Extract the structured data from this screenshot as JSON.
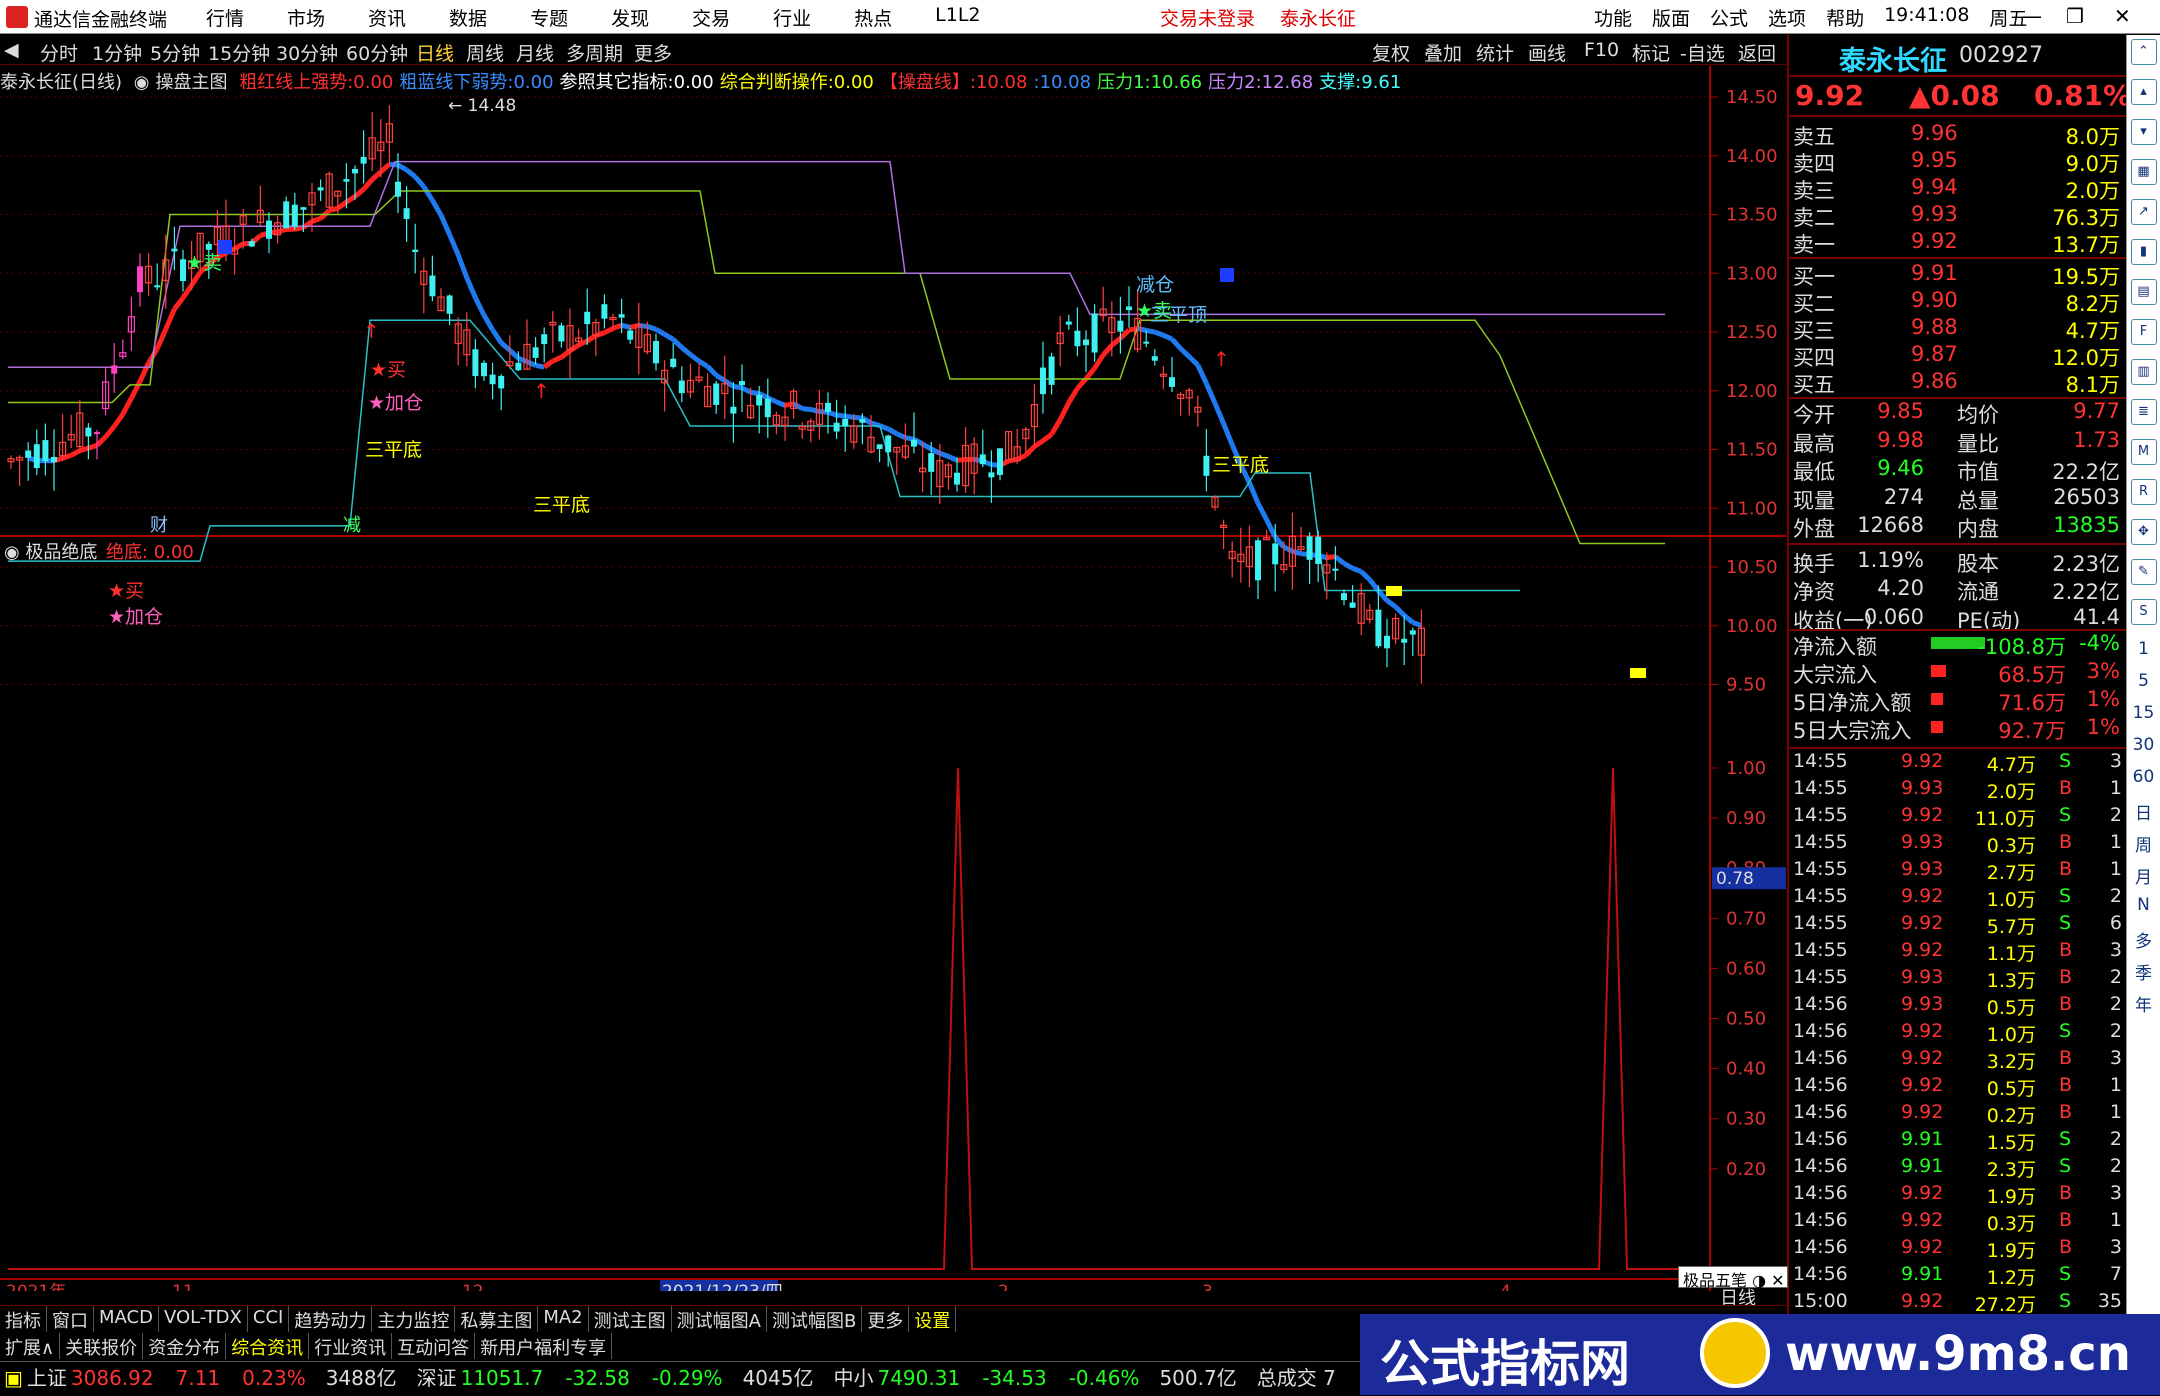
{
  "titlebar": {
    "app_name": "通达信金融终端",
    "menu": [
      "行情",
      "市场",
      "资讯",
      "数据",
      "专题",
      "发现",
      "交易",
      "行业",
      "热点",
      "L1L2"
    ],
    "login_status": "交易未登录",
    "stock_name": "泰永长征",
    "right_menu": [
      "功能",
      "版面",
      "公式",
      "选项",
      "帮助"
    ],
    "clock": "19:41:08",
    "weekday": "周五"
  },
  "period_bar": {
    "periods": [
      "分时",
      "1分钟",
      "5分钟",
      "15分钟",
      "30分钟",
      "60分钟",
      "日线",
      "周线",
      "月线",
      "多周期",
      "更多"
    ],
    "active": "日线",
    "tools": [
      "复权",
      "叠加",
      "统计",
      "画线",
      "F10",
      "标记",
      "-自选",
      "返回"
    ]
  },
  "main_indicator": {
    "title": "泰永长征(日线)",
    "formula": "操盘主图",
    "items": [
      {
        "label": "粗红线上强势:",
        "value": "0.00",
        "color": "#ff3030"
      },
      {
        "label": "粗蓝线下弱势:",
        "value": "0.00",
        "color": "#3a8cff"
      },
      {
        "label": "参照其它指标:",
        "value": "0.00",
        "color": "#ffffff"
      },
      {
        "label": "综合判断操作:",
        "value": "0.00",
        "color": "#ffff00"
      },
      {
        "label": "【操盘线】:",
        "value": "10.08",
        "color": "#ff3030"
      },
      {
        "label": ":",
        "value": "10.08",
        "color": "#3a8cff"
      },
      {
        "label": "压力1:",
        "value": "10.66",
        "color": "#44ff44"
      },
      {
        "label": "压力2:",
        "value": "12.68",
        "color": "#cc88ff"
      },
      {
        "label": "支撑:",
        "value": "9.61",
        "color": "#44ffff"
      }
    ],
    "high_label": "14.48"
  },
  "chart_data": [
    {
      "type": "candlestick",
      "title": "泰永长征(日线)",
      "y_ticks": [
        "14.50",
        "14.00",
        "13.50",
        "13.00",
        "12.50",
        "12.00",
        "11.50",
        "11.00",
        "10.50",
        "10.00",
        "9.50"
      ],
      "ylim": [
        9.25,
        14.55
      ],
      "annotations": [
        "★卖",
        "★买",
        "★加仓",
        "三平底",
        "三平底",
        "减仓",
        "★卖",
        "三平顶",
        "三平底",
        "★买",
        "★加仓"
      ],
      "x_labels": [
        "2021年",
        "11",
        "12",
        "2021/12/23/四",
        "2",
        "3",
        "4"
      ],
      "markers": [
        "财",
        "减"
      ]
    },
    {
      "type": "line",
      "title": "极品绝底",
      "series": [
        {
          "name": "绝底",
          "value": "0.00"
        }
      ],
      "y_ticks": [
        "1.00",
        "0.90",
        "0.80",
        "0.70",
        "0.60",
        "0.50",
        "0.40",
        "0.30",
        "0.20"
      ],
      "ylim": [
        0,
        1.07
      ],
      "cursor_value": "0.78",
      "spikes": [
        1,
        1
      ]
    }
  ],
  "quote": {
    "name": "泰永长征",
    "code": "002927",
    "price": "9.92",
    "change": "▲0.08",
    "pct": "0.81%",
    "asks": [
      {
        "label": "卖五",
        "price": "9.96",
        "vol": "8.0万"
      },
      {
        "label": "卖四",
        "price": "9.95",
        "vol": "9.0万"
      },
      {
        "label": "卖三",
        "price": "9.94",
        "vol": "2.0万"
      },
      {
        "label": "卖二",
        "price": "9.93",
        "vol": "76.3万"
      },
      {
        "label": "卖一",
        "price": "9.92",
        "vol": "13.7万"
      }
    ],
    "bids": [
      {
        "label": "买一",
        "price": "9.91",
        "vol": "19.5万"
      },
      {
        "label": "买二",
        "price": "9.90",
        "vol": "8.2万"
      },
      {
        "label": "买三",
        "price": "9.88",
        "vol": "4.7万"
      },
      {
        "label": "买四",
        "price": "9.87",
        "vol": "12.0万"
      },
      {
        "label": "买五",
        "price": "9.86",
        "vol": "8.1万"
      }
    ],
    "stats": [
      [
        "今开",
        "9.85",
        "均价",
        "9.77"
      ],
      [
        "最高",
        "9.98",
        "量比",
        "1.73"
      ],
      [
        "最低",
        "9.46",
        "市值",
        "22.2亿"
      ],
      [
        "现量",
        "274",
        "总量",
        "26503"
      ],
      [
        "外盘",
        "12668",
        "内盘",
        "13835"
      ],
      [
        "换手",
        "1.19%",
        "股本",
        "2.23亿"
      ],
      [
        "净资",
        "4.20",
        "流通",
        "2.22亿"
      ],
      [
        "收益(一)",
        "0.060",
        "PE(动)",
        "41.4"
      ]
    ],
    "flows": [
      {
        "label": "净流入额",
        "value": "-108.8万",
        "pct": "-4%",
        "color": "#2c2",
        "bar": 0.9
      },
      {
        "label": "大宗流入",
        "value": "68.5万",
        "pct": "3%",
        "color": "#f22",
        "bar": 0.25
      },
      {
        "label": "5日净流入额",
        "value": "71.6万",
        "pct": "1%",
        "color": "#f22",
        "bar": 0.2
      },
      {
        "label": "5日大宗流入",
        "value": "92.7万",
        "pct": "1%",
        "color": "#f22",
        "bar": 0.2
      }
    ],
    "ticks": [
      [
        "14:55",
        "9.92",
        "4.7万",
        "S",
        "3"
      ],
      [
        "14:55",
        "9.93",
        "2.0万",
        "B",
        "1"
      ],
      [
        "14:55",
        "9.92",
        "11.0万",
        "S",
        "2"
      ],
      [
        "14:55",
        "9.93",
        "0.3万",
        "B",
        "1"
      ],
      [
        "14:55",
        "9.93",
        "2.7万",
        "B",
        "1"
      ],
      [
        "14:55",
        "9.92",
        "1.0万",
        "S",
        "2"
      ],
      [
        "14:55",
        "9.92",
        "5.7万",
        "S",
        "6"
      ],
      [
        "14:55",
        "9.92",
        "1.1万",
        "B",
        "3"
      ],
      [
        "14:55",
        "9.93",
        "1.3万",
        "B",
        "2"
      ],
      [
        "14:56",
        "9.93",
        "0.5万",
        "B",
        "2"
      ],
      [
        "14:56",
        "9.92",
        "1.0万",
        "S",
        "2"
      ],
      [
        "14:56",
        "9.92",
        "3.2万",
        "B",
        "3"
      ],
      [
        "14:56",
        "9.92",
        "0.5万",
        "B",
        "1"
      ],
      [
        "14:56",
        "9.92",
        "0.2万",
        "B",
        "1"
      ],
      [
        "14:56",
        "9.91",
        "1.5万",
        "S",
        "2"
      ],
      [
        "14:56",
        "9.91",
        "2.3万",
        "S",
        "2"
      ],
      [
        "14:56",
        "9.92",
        "1.9万",
        "B",
        "3"
      ],
      [
        "14:56",
        "9.92",
        "0.3万",
        "B",
        "1"
      ],
      [
        "14:56",
        "9.92",
        "1.9万",
        "B",
        "3"
      ],
      [
        "14:56",
        "9.91",
        "1.2万",
        "S",
        "7"
      ],
      [
        "15:00",
        "9.92",
        "27.2万",
        "S",
        "35"
      ]
    ],
    "bottom_label": "日线",
    "popup": "极品五笔"
  },
  "sub_indicator": {
    "title": "极品绝底",
    "label": "绝底:",
    "value": "0.00"
  },
  "side_icons": [
    "1",
    "5",
    "15",
    "30",
    "60",
    "日",
    "周",
    "月",
    "N",
    "多",
    "季",
    "年"
  ],
  "bottom_tabs": [
    "指标",
    "窗口",
    "MACD",
    "VOL-TDX",
    "CCI",
    "趋势动力",
    "主力监控",
    "私募主图",
    "MA2",
    "测试主图",
    "测试幅图A",
    "测试幅图B",
    "更多",
    "设置"
  ],
  "bottom_tabs2": [
    "扩展∧",
    "关联报价",
    "资金分布",
    "综合资讯",
    "行业资讯",
    "互动问答",
    "新用户福利专享"
  ],
  "status": [
    {
      "name": "上证",
      "value": "3086.92",
      "chg": "7.11",
      "pct": "0.23%",
      "amt": "3488亿"
    },
    {
      "name": "深证",
      "value": "11051.7",
      "chg": "-32.58",
      "pct": "-0.29%",
      "amt": "4045亿"
    },
    {
      "name": "中小",
      "value": "7490.31",
      "chg": "-34.53",
      "pct": "-0.46%",
      "amt": "500.7亿"
    }
  ],
  "status_extra": "总成交 7",
  "watermark": {
    "text1": "公式指标网",
    "text2": "www.9m8.cn"
  }
}
